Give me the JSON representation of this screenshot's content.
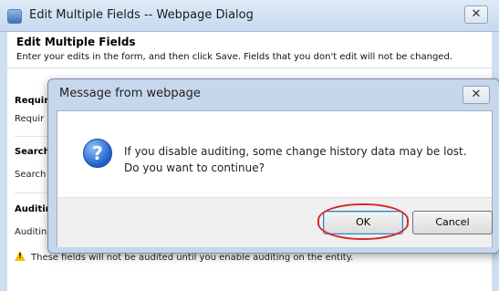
{
  "outer_window": {
    "title": "Edit Multiple Fields -- Webpage Dialog",
    "close_glyph": "✕"
  },
  "form": {
    "title": "Edit Multiple Fields",
    "subtitle": "Enter your edits in the form, and then click Save. Fields that you don't edit will not be changed.",
    "sections": [
      {
        "label": "Requir",
        "field": "Requir"
      },
      {
        "label": "Search",
        "field": "Search"
      },
      {
        "label": "Auditin",
        "field": "Auditin"
      }
    ],
    "warning": "These fields will not be audited until you enable auditing on the entity."
  },
  "message_box": {
    "title": "Message from webpage",
    "close_glyph": "✕",
    "icon": "question-icon",
    "line1": "If you disable auditing, some change history data may be lost.",
    "line2": "Do you want to continue?",
    "ok_label": "OK",
    "cancel_label": "Cancel"
  },
  "colors": {
    "chrome": "#c7d9ef",
    "highlight_ring": "#d32b2b",
    "warning": "#f2c200"
  }
}
